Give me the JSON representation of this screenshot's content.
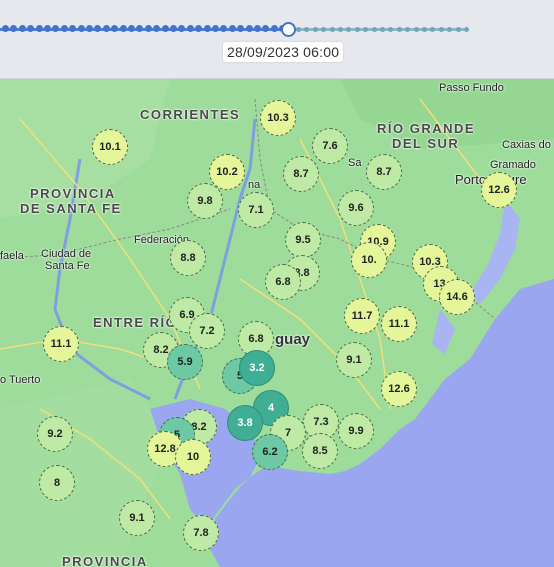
{
  "timeline": {
    "date_label": "28/09/2023 06:00",
    "progress": 0.62
  },
  "colors": {
    "water": "#9aa7f0",
    "land": "#9ddc9a",
    "marker_warm": "#e4f59a",
    "marker_mid": "#bfeaa6",
    "marker_cool": "#6cc9a4",
    "marker_cold": "#3fae94"
  },
  "places": {
    "corrientes": "CORRIENTES",
    "rio_grande_1": "RÍO GRANDE",
    "rio_grande_2": "DEL SUR",
    "santa_fe_1": "PROVINCIA",
    "santa_fe_2": "DE SANTA FE",
    "entre_rios": "ENTRE RÍO",
    "uruguay": "guay",
    "passo_fundo": "Passo Fundo",
    "caxias": "Caxias do",
    "gramado": "Gramado",
    "porto_alegre": "Porto Alegre",
    "federacion": "Federación",
    "ciudad_santa_fe_1": "Ciudad de",
    "ciudad_santa_fe_2": "Santa Fe",
    "rafaela": "faela",
    "parana": "Paraná",
    "rio_cuarto": "o Tuerto",
    "bs_as": "PROVINCIA",
    "sa_fragment": "Sa",
    "ba_fragment": "Bu",
    "mo_fragment": "M",
    "na_fragment": "na"
  },
  "markers": [
    {
      "label": "10.1"
    },
    {
      "label": "10.3"
    },
    {
      "label": "7.6"
    },
    {
      "label": "10.2"
    },
    {
      "label": "8.7"
    },
    {
      "label": "8.7"
    },
    {
      "label": "9.8"
    },
    {
      "label": "7.1"
    },
    {
      "label": "9.6"
    },
    {
      "label": "12.6"
    },
    {
      "label": "9.5"
    },
    {
      "label": "10.9"
    },
    {
      "label": "8.8"
    },
    {
      "label": "10."
    },
    {
      "label": "10.3"
    },
    {
      "label": "8.8"
    },
    {
      "label": "6.8"
    },
    {
      "label": "13."
    },
    {
      "label": "14.6"
    },
    {
      "label": "6.9"
    },
    {
      "label": "11.7"
    },
    {
      "label": "11.1"
    },
    {
      "label": "7.2"
    },
    {
      "label": "11.1"
    },
    {
      "label": "6.8"
    },
    {
      "label": "8.2"
    },
    {
      "label": "5.9"
    },
    {
      "label": "9.1"
    },
    {
      "label": "5"
    },
    {
      "label": "3.2"
    },
    {
      "label": "12.6"
    },
    {
      "label": "4"
    },
    {
      "label": "7.3"
    },
    {
      "label": "3.8"
    },
    {
      "label": "8.2"
    },
    {
      "label": "5"
    },
    {
      "label": "9.9"
    },
    {
      "label": "7"
    },
    {
      "label": "9.2"
    },
    {
      "label": "12.8"
    },
    {
      "label": "6.2"
    },
    {
      "label": "8.5"
    },
    {
      "label": "10"
    },
    {
      "label": "8"
    },
    {
      "label": "9.1"
    },
    {
      "label": "7.8"
    }
  ]
}
